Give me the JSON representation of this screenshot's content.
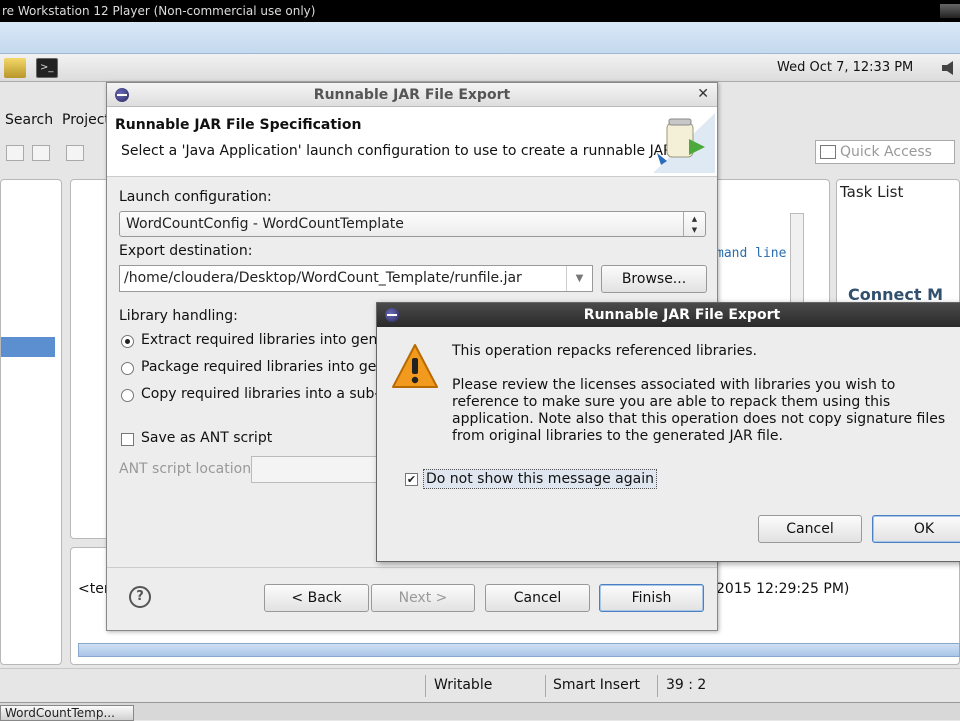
{
  "vm": {
    "title": "re Workstation 12 Player (Non-commercial use only)"
  },
  "panel": {
    "clock": "Wed Oct  7, 12:33 PM"
  },
  "eclipse": {
    "menu": [
      "Search",
      "Project"
    ],
    "quick_access_placeholder": "Quick Access",
    "task_list_tab": "Task List",
    "connect_label": "Connect M",
    "editor_snippet": "mand line",
    "console_snippet": "<ter",
    "console_date": "2015 12:29:25 PM)"
  },
  "statusbar": {
    "writable": "Writable",
    "insert_mode": "Smart Insert",
    "position": "39 : 2"
  },
  "taskbar": {
    "item": "WordCountTemp..."
  },
  "wizard": {
    "title": "Runnable JAR File Export",
    "heading": "Runnable JAR File Specification",
    "description": "Select a 'Java Application' launch configuration to use to create a runnable JAR.",
    "launch_label": "Launch configuration:",
    "launch_value": "WordCountConfig - WordCountTemplate",
    "dest_label": "Export destination:",
    "dest_value": "/home/cloudera/Desktop/WordCount_Template/runfile.jar",
    "browse": "Browse...",
    "library_label": "Library handling:",
    "options": [
      "Extract required libraries into genera",
      "Package required libraries into gener",
      "Copy required libraries into a sub-fol"
    ],
    "selected_option_index": 0,
    "save_ant": "Save as ANT script",
    "save_ant_checked": false,
    "ant_location_label": "ANT script location:",
    "back": "< Back",
    "next": "Next >",
    "cancel": "Cancel",
    "finish": "Finish"
  },
  "confirm": {
    "title": "Runnable JAR File Export",
    "line1": "This operation repacks referenced libraries.",
    "line2": "Please review the licenses associated with libraries you wish to reference to make sure you are able to repack them using this application. Note also that this operation does not copy signature files from original libraries to the generated JAR file.",
    "checkbox": "Do not show this message again",
    "checkbox_checked": true,
    "cancel": "Cancel",
    "ok": "OK"
  }
}
